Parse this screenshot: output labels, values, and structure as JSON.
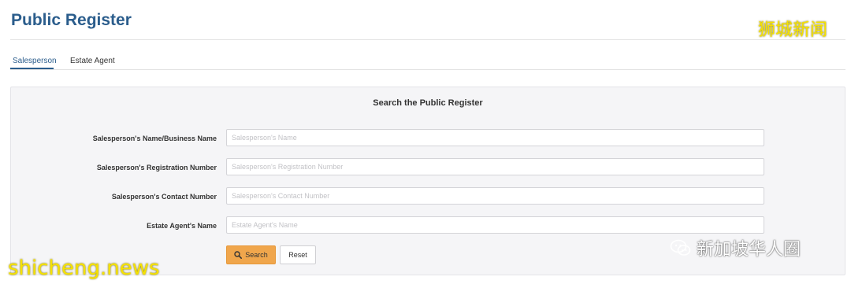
{
  "header": {
    "title": "Public Register"
  },
  "tabs": [
    {
      "label": "Salesperson",
      "active": true
    },
    {
      "label": "Estate Agent",
      "active": false
    }
  ],
  "search_panel": {
    "heading": "Search the Public Register",
    "fields": [
      {
        "label": "Salesperson's Name/Business Name",
        "placeholder": "Salesperson's Name",
        "value": ""
      },
      {
        "label": "Salesperson's Registration Number",
        "placeholder": "Salesperson's Registration Number",
        "value": ""
      },
      {
        "label": "Salesperson's Contact Number",
        "placeholder": "Salesperson's Contact Number",
        "value": ""
      },
      {
        "label": "Estate Agent's Name",
        "placeholder": "Estate Agent's Name",
        "value": ""
      }
    ],
    "buttons": {
      "search_label": "Search",
      "reset_label": "Reset"
    },
    "icons": {
      "search": "search-icon"
    }
  },
  "watermarks": {
    "top_right": "狮城新闻",
    "bottom_left": "shicheng.news",
    "bottom_right": "新加坡华人圈",
    "bottom_right_icon": "wechat-icon"
  },
  "colors": {
    "title": "#2b5d8c",
    "accent_button": "#f0a64c",
    "panel_bg": "#f5f5f7",
    "watermark_yellow": "#f5e100"
  }
}
